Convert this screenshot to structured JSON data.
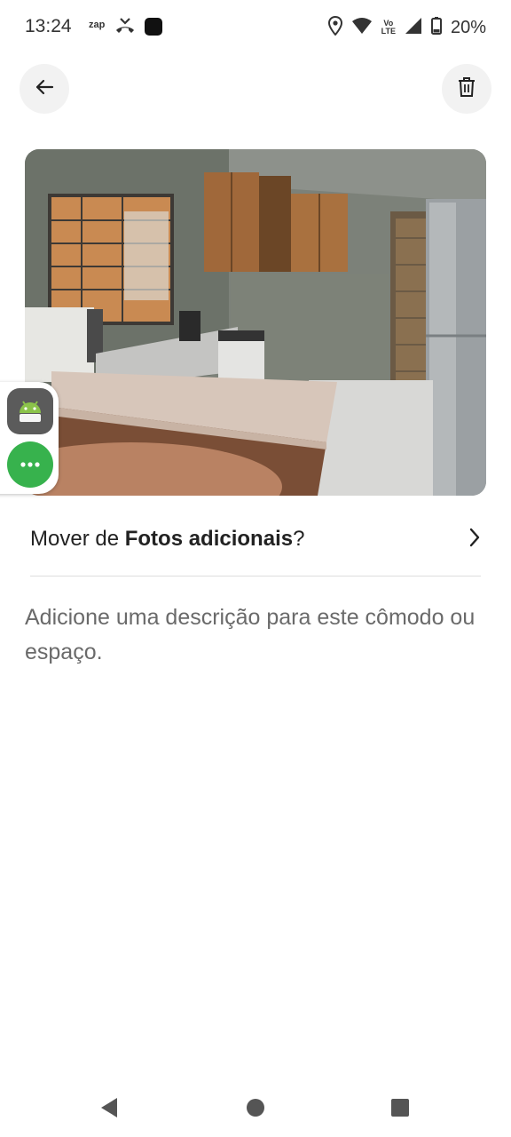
{
  "status_bar": {
    "time": "13:24",
    "zap_label": "zap",
    "volte_top": "Vo",
    "volte_bottom": "LTE",
    "battery": "20%"
  },
  "header": {
    "back_icon": "arrow-left-icon",
    "delete_icon": "trash-icon"
  },
  "photo": {
    "subject": "kitchen"
  },
  "floating_bubbles": {
    "android_icon": "android-icon",
    "more_icon": "more-dots-icon"
  },
  "move_row": {
    "prefix": "Mover de ",
    "album": "Fotos adicionais",
    "suffix": "?"
  },
  "description": {
    "placeholder": "Adicione uma descrição para este cômodo ou espaço."
  },
  "colors": {
    "accent_green": "#37b24d",
    "muted_text": "#6a6a6a",
    "divider": "#dddddd"
  }
}
